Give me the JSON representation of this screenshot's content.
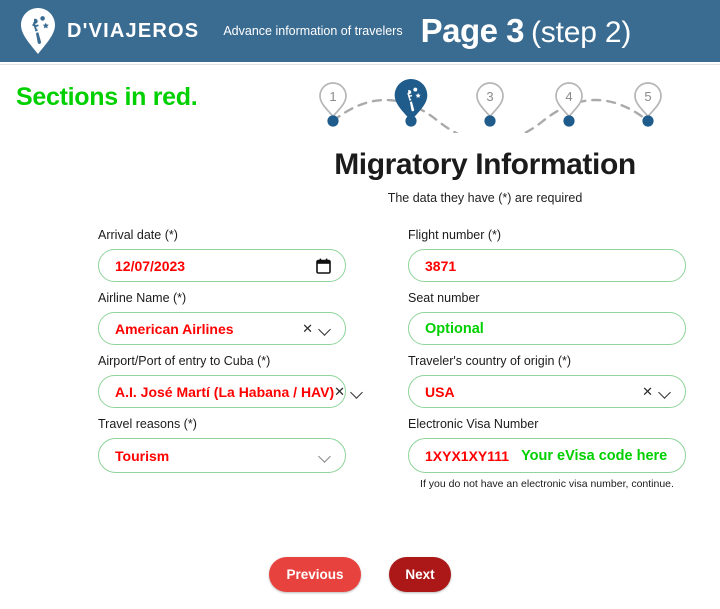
{
  "header": {
    "brand": "D'VIAJEROS",
    "logo_icon": "viajeros-pin-logo",
    "subtitle": "Advance information of travelers",
    "page_strong": "Page 3",
    "page_light": "(step 2)"
  },
  "annotation": {
    "red_note": "Sections in red."
  },
  "stepper": {
    "steps": [
      {
        "label": "1",
        "state": "pending"
      },
      {
        "label": "",
        "state": "active",
        "icon": "viajeros-pin-logo"
      },
      {
        "label": "3",
        "state": "pending"
      },
      {
        "label": "4",
        "state": "pending"
      },
      {
        "label": "5",
        "state": "pending"
      }
    ],
    "colors": {
      "dot": "#1f5c8b",
      "pin_outline": "#b6b6b6",
      "active_pin": "#1f5c8b",
      "line": "#aaaaaa"
    }
  },
  "main": {
    "title": "Migratory Information",
    "subtitle": "The data they have (*) are required"
  },
  "fields": {
    "arrival_date": {
      "label": "Arrival date (*)",
      "value": "12/07/2023",
      "icon": "calendar-icon"
    },
    "flight_number": {
      "label": "Flight number (*)",
      "value": "3871"
    },
    "airline_name": {
      "label": "Airline Name (*)",
      "value": "American Airlines",
      "clear_icon": "close-icon",
      "dropdown_icon": "chevron-down-icon"
    },
    "seat_number": {
      "label": "Seat number",
      "value": "",
      "annotation": "Optional"
    },
    "airport_entry": {
      "label": "Airport/Port of entry to Cuba (*)",
      "value": "A.I. José Martí (La Habana / HAV)",
      "clear_icon": "close-icon",
      "dropdown_icon": "chevron-down-icon"
    },
    "country_origin": {
      "label": "Traveler's country of origin (*)",
      "value": "USA",
      "clear_icon": "close-icon",
      "dropdown_icon": "chevron-down-icon"
    },
    "travel_reasons": {
      "label": "Travel reasons (*)",
      "value": "Tourism",
      "dropdown_icon": "chevron-down-icon"
    },
    "evisa_number": {
      "label": "Electronic Visa Number",
      "value": "1XYX1XY111",
      "annotation": "Your eVisa code here",
      "helper": "If you do not have an electronic visa number, continue."
    }
  },
  "buttons": {
    "previous": "Previous",
    "next": "Next"
  },
  "colors": {
    "header_bg": "#3a6b91",
    "accent_green": "#00d000",
    "value_red": "#ff0000",
    "field_border": "#8fd49a",
    "btn_prev": "#e8423f",
    "btn_next": "#ac1717"
  }
}
